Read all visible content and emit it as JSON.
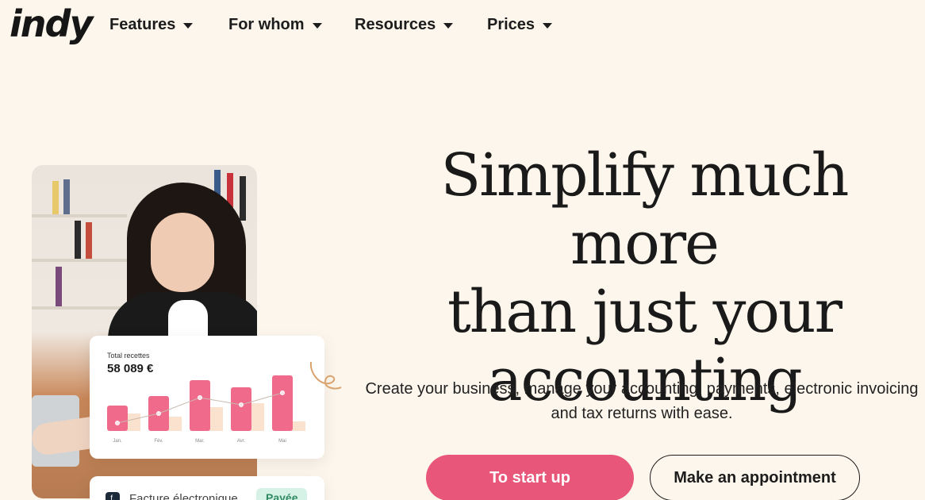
{
  "nav": {
    "logo": "indy",
    "items": [
      {
        "label": "Features"
      },
      {
        "label": "For whom"
      },
      {
        "label": "Resources"
      },
      {
        "label": "Prices"
      }
    ]
  },
  "hero": {
    "headline_line1": "Simplify much more",
    "headline_line2": "than just your",
    "headline_line3": "accounting",
    "subtitle_line1": "Create your business, manage your accounting, payments, electronic invoicing",
    "subtitle_line2": "and tax returns with ease.",
    "primary_cta": "To start up",
    "secondary_cta": "Make an appointment"
  },
  "revenue_card": {
    "label": "Total recettes",
    "value": "58 089 €",
    "months": [
      "Jan.",
      "Fév.",
      "Mar.",
      "Avr.",
      "Mai"
    ],
    "bars": [
      0.32,
      0.44,
      0.64,
      0.55,
      0.7
    ],
    "secondary_bars": [
      0.22,
      0.18,
      0.3,
      0.35,
      0.12
    ],
    "colors": {
      "bar": "#f06a8c",
      "secondary": "#fbe2cf",
      "line": "#c9b9ae"
    }
  },
  "invoice_card": {
    "icon": "f.",
    "text": "Facture électronique",
    "badge": "Payée"
  }
}
